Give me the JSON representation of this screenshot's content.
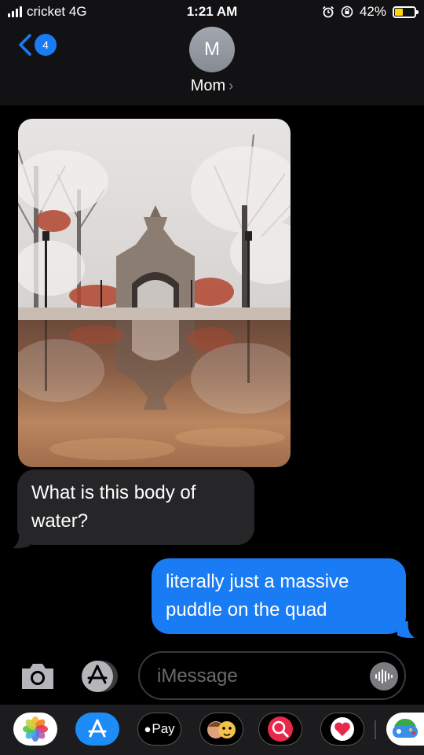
{
  "status_bar": {
    "carrier": "cricket 4G",
    "time": "1:21 AM",
    "battery": "42%",
    "battery_level": 0.42,
    "battery_color": "#ffd60a",
    "icons": [
      "signal-bars-icon",
      "alarm-icon",
      "rotation-lock-icon",
      "battery-icon"
    ]
  },
  "nav": {
    "unread_count": "4",
    "contact_initial": "M",
    "contact_name": "Mom"
  },
  "messages": [
    {
      "sender": "Mom",
      "type": "image"
    },
    {
      "sender": "Mom",
      "type": "text",
      "text": "What is this body of water?"
    },
    {
      "sender": "me",
      "type": "text",
      "text": "literally just a massive puddle on the quad"
    }
  ],
  "composer": {
    "placeholder": "iMessage"
  },
  "app_tray": {
    "apple_pay_label": "Pay",
    "apps": [
      "photos-icon",
      "app-store-icon",
      "apple-pay-icon",
      "memoji-icon",
      "web-search-icon",
      "digital-touch-icon",
      "game-icon"
    ]
  },
  "colors": {
    "accent": "#1a7cf5",
    "incoming_bubble": "#262628",
    "header_bg": "#121214"
  }
}
